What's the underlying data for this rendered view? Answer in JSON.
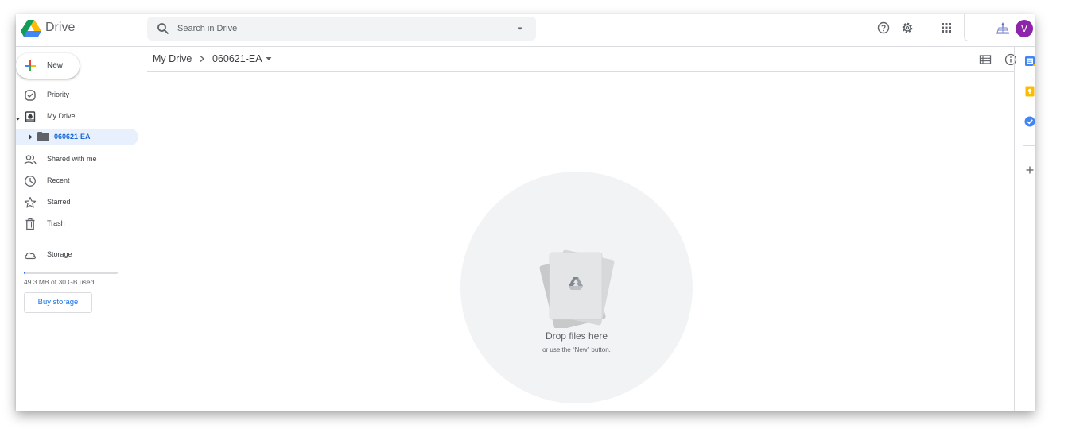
{
  "header": {
    "brand": "Drive",
    "search_placeholder": "Search in Drive",
    "avatar_letter": "V",
    "colors": {
      "avatar": "#8e24aa"
    }
  },
  "sidebar": {
    "new_label": "New",
    "items": [
      {
        "label": "Priority",
        "icon": "priority-icon"
      },
      {
        "label": "My Drive",
        "icon": "my-drive-icon"
      },
      {
        "label": "Shared with me",
        "icon": "shared-icon"
      },
      {
        "label": "Recent",
        "icon": "clock-icon"
      },
      {
        "label": "Starred",
        "icon": "star-icon"
      },
      {
        "label": "Trash",
        "icon": "trash-icon"
      },
      {
        "label": "Storage",
        "icon": "cloud-icon"
      }
    ],
    "folder": {
      "label": "060621-EA",
      "icon": "folder-icon"
    },
    "storage": {
      "used_text": "49.3 MB of 30 GB used",
      "fraction_used": 0.002
    },
    "buy_label": "Buy storage"
  },
  "main": {
    "breadcrumb": {
      "root": "My Drive",
      "current": "060621-EA"
    },
    "empty_state": {
      "title": "Drop files here",
      "subtitle": "or use the “New” button."
    }
  },
  "colors": {
    "accent": "#1a73e8",
    "selected_bg": "#e8f0fe",
    "selected_text": "#1967d2"
  }
}
